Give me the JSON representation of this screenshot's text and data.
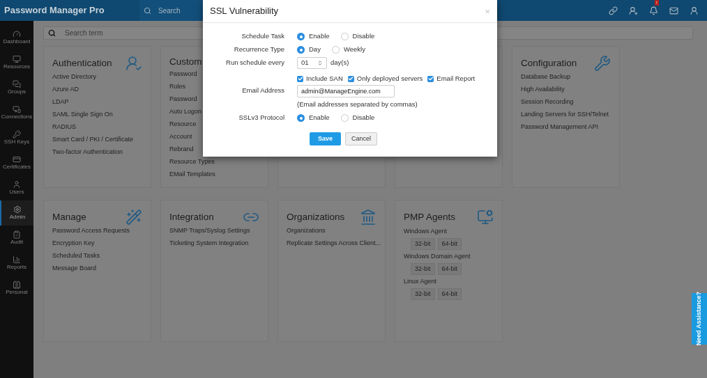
{
  "header": {
    "logo": "Password Manager Pro",
    "search_placeholder": "Search",
    "notification_badge": "!"
  },
  "sidebar": {
    "items": [
      {
        "label": "Dashboard",
        "selected": false
      },
      {
        "label": "Resources",
        "selected": false
      },
      {
        "label": "Groups",
        "selected": false
      },
      {
        "label": "Connections",
        "selected": false
      },
      {
        "label": "SSH Keys",
        "selected": false
      },
      {
        "label": "Certificates",
        "selected": false
      },
      {
        "label": "Users",
        "selected": false
      },
      {
        "label": "Admin",
        "selected": true
      },
      {
        "label": "Audit",
        "selected": false
      },
      {
        "label": "Reports",
        "selected": false
      },
      {
        "label": "Personal",
        "selected": false
      }
    ]
  },
  "search": {
    "placeholder": "Search term"
  },
  "cards": [
    {
      "kind": "links",
      "title": "Authentication",
      "items": [
        "Active Directory",
        "Azure AD",
        "LDAP",
        "SAML Single Sign On",
        "RADIUS",
        "Smart Card / PKI / Certificate",
        "Two-factor Authentication"
      ]
    },
    {
      "kind": "links",
      "title": "Custom",
      "items": [
        "Password",
        "Roles",
        "Password",
        "Auto Logon",
        "Resource",
        "Account",
        "Rebrand",
        "Resource Types",
        "EMail Templates"
      ]
    },
    {
      "kind": "blank"
    },
    {
      "kind": "blank"
    },
    {
      "kind": "links",
      "title": "Configuration",
      "items": [
        "Database Backup",
        "High Availability",
        "Session Recording",
        "Landing Servers for SSH/Telnet",
        "Password Management API"
      ]
    },
    {
      "kind": "links",
      "title": "Manage",
      "items": [
        "Password Access Requests",
        "Encryption Key",
        "Scheduled Tasks",
        "Message Board"
      ]
    },
    {
      "kind": "links",
      "title": "Integration",
      "items": [
        "SNMP Traps/Syslog Settings",
        "Ticketing System Integration"
      ]
    },
    {
      "kind": "links",
      "title": "Organizations",
      "items": [
        "Organizations",
        "Replicate Settings Across Client..."
      ]
    },
    {
      "kind": "agents",
      "title": "PMP Agents",
      "groups": [
        {
          "name": "Windows Agent",
          "buttons": [
            "32-bit",
            "64-bit"
          ]
        },
        {
          "name": "Windows Domain Agent",
          "buttons": [
            "32-bit",
            "64-bit"
          ]
        },
        {
          "name": "Linux Agent",
          "buttons": [
            "32-bit",
            "64-bit"
          ]
        }
      ]
    }
  ],
  "dialog": {
    "title": "SSL Vulnerability",
    "close": "×",
    "rows": [
      {
        "kind": "radio",
        "label": "Schedule Task",
        "options": [
          {
            "label": "Enable",
            "selected": true
          },
          {
            "label": "Disable",
            "selected": false
          }
        ]
      },
      {
        "kind": "radio",
        "label": "Recurrence Type",
        "options": [
          {
            "label": "Day",
            "selected": true
          },
          {
            "label": "Weekly",
            "selected": false
          }
        ]
      },
      {
        "kind": "number",
        "label": "Run schedule every",
        "value": "01",
        "unit": "day(s)"
      },
      {
        "kind": "checks",
        "options": [
          {
            "label": "Include SAN",
            "checked": true
          },
          {
            "label": "Only deployed servers",
            "checked": true
          },
          {
            "label": "Email Report",
            "checked": true
          }
        ]
      },
      {
        "kind": "text",
        "label": "Email Address",
        "value": "admin@ManageEngine.com"
      },
      {
        "kind": "hint",
        "text": "(Email addresses separated by commas)"
      },
      {
        "kind": "radio",
        "label": "SSLv3 Protocol",
        "options": [
          {
            "label": "Enable",
            "selected": true
          },
          {
            "label": "Disable",
            "selected": false
          }
        ]
      }
    ],
    "buttons": [
      {
        "label": "Save",
        "kind": "primary"
      },
      {
        "label": "Cancel",
        "kind": "secondary"
      }
    ]
  },
  "help_tab": "Need Assistance?"
}
